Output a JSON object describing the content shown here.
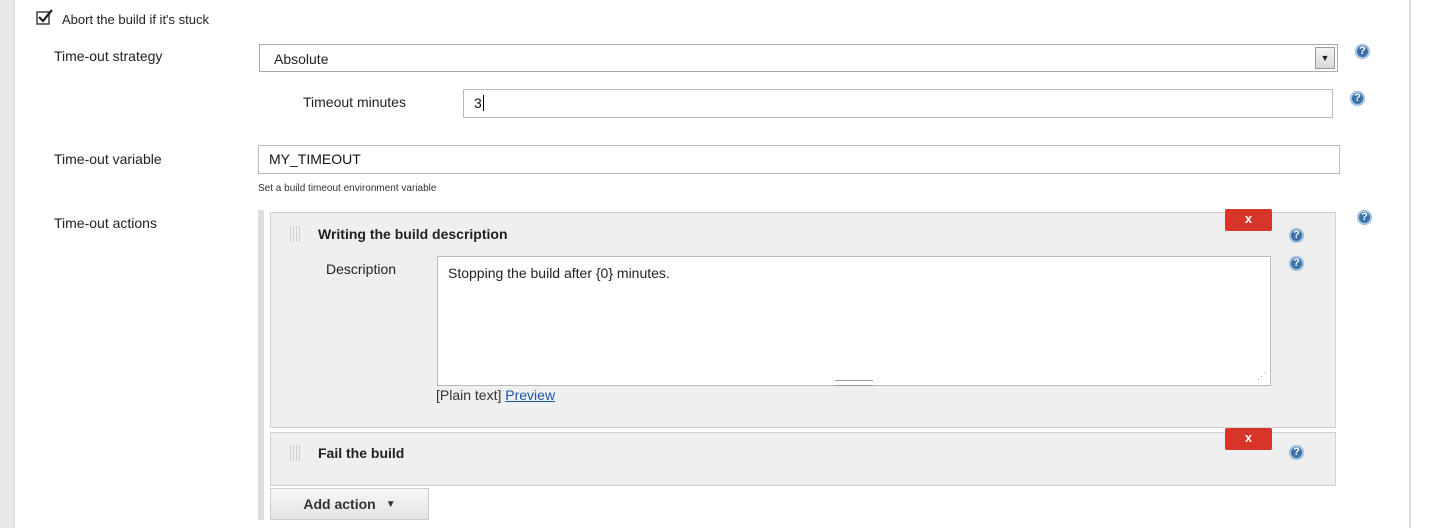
{
  "abort": {
    "label": "Abort the build if it's stuck",
    "checked": true
  },
  "strategy": {
    "label": "Time-out strategy",
    "value": "Absolute"
  },
  "timeout_minutes": {
    "label": "Timeout minutes",
    "value": "3"
  },
  "variable": {
    "label": "Time-out variable",
    "value": "MY_TIMEOUT",
    "hint": "Set a build timeout environment variable"
  },
  "actions": {
    "label": "Time-out actions",
    "items": [
      {
        "title": "Writing the build description",
        "description_label": "Description",
        "description_value": "Stopping the build after {0} minutes.",
        "plain_text": "[Plain text]",
        "preview": "Preview"
      },
      {
        "title": "Fail the build"
      }
    ],
    "delete_label": "x",
    "add_label": "Add action"
  },
  "help_icon": "question-mark",
  "colors": {
    "delete": "#d7342a",
    "help": "#3b72a8",
    "link": "#1a56a8"
  }
}
